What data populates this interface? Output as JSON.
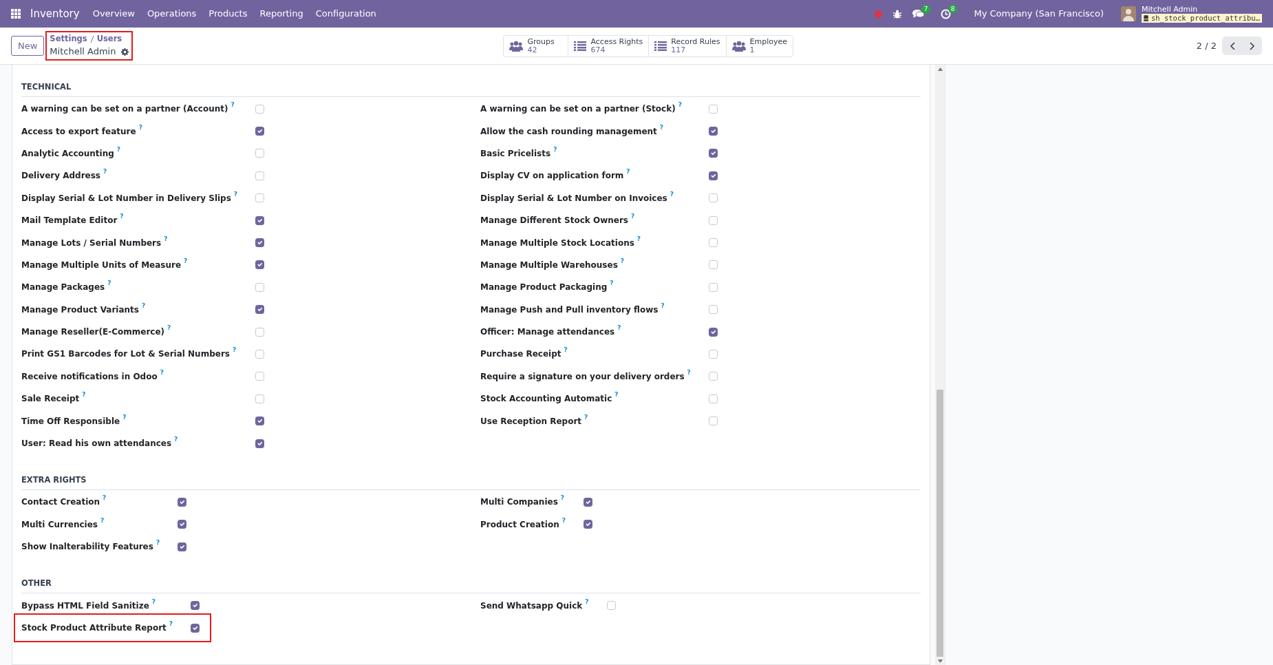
{
  "navbar": {
    "app_name": "Inventory",
    "menus": [
      "Overview",
      "Operations",
      "Products",
      "Reporting",
      "Configuration"
    ],
    "chat_count": "7",
    "activity_count": "8",
    "company": "My Company (San Francisco)",
    "user_name": "Mitchell Admin",
    "database": "sh_stock_product_attribu…"
  },
  "control_panel": {
    "new_button": "New",
    "breadcrumbs": [
      "Settings",
      "Users"
    ],
    "record_name": "Mitchell Admin",
    "highlighted": true,
    "smart_buttons": [
      {
        "kind": "group",
        "label": "Groups",
        "value": "42"
      },
      {
        "kind": "list",
        "label": "Access Rights",
        "value": "674"
      },
      {
        "kind": "list",
        "label": "Record Rules",
        "value": "117"
      },
      {
        "kind": "group",
        "label": "Employee",
        "value": "1"
      }
    ],
    "pager": "2 / 2"
  },
  "sections": [
    {
      "title": "TECHNICAL",
      "left": [
        {
          "label": "A warning can be set on a partner (Account)",
          "help": "?",
          "checked": false
        },
        {
          "label": "Access to export feature",
          "help": "?",
          "checked": true
        },
        {
          "label": "Analytic Accounting",
          "help": "?",
          "checked": false
        },
        {
          "label": "Delivery Address",
          "help": "?",
          "checked": false
        },
        {
          "label": "Display Serial & Lot Number in Delivery Slips",
          "help": "?",
          "checked": false
        },
        {
          "label": "Mail Template Editor",
          "help": "?",
          "checked": true
        },
        {
          "label": "Manage Lots / Serial Numbers",
          "help": "?",
          "checked": true
        },
        {
          "label": "Manage Multiple Units of Measure",
          "help": "?",
          "checked": true
        },
        {
          "label": "Manage Packages",
          "help": "?",
          "checked": false
        },
        {
          "label": "Manage Product Variants",
          "help": "?",
          "checked": true
        },
        {
          "label": "Manage Reseller(E-Commerce)",
          "help": "?",
          "checked": false
        },
        {
          "label": "Print GS1 Barcodes for Lot & Serial Numbers",
          "help": "?",
          "checked": false
        },
        {
          "label": "Receive notifications in Odoo",
          "help": "?",
          "checked": false
        },
        {
          "label": "Sale Receipt",
          "help": "?",
          "checked": false
        },
        {
          "label": "Time Off Responsible",
          "help": "?",
          "checked": true
        },
        {
          "label": "User: Read his own attendances",
          "help": "?",
          "checked": true
        }
      ],
      "right": [
        {
          "label": "A warning can be set on a partner (Stock)",
          "help": "?",
          "checked": false
        },
        {
          "label": "Allow the cash rounding management",
          "help": "?",
          "checked": true
        },
        {
          "label": "Basic Pricelists",
          "help": "?",
          "checked": true
        },
        {
          "label": "Display CV on application form",
          "help": "?",
          "checked": true
        },
        {
          "label": "Display Serial & Lot Number on Invoices",
          "help": "?",
          "checked": false
        },
        {
          "label": "Manage Different Stock Owners",
          "help": "?",
          "checked": false
        },
        {
          "label": "Manage Multiple Stock Locations",
          "help": "?",
          "checked": false
        },
        {
          "label": "Manage Multiple Warehouses",
          "help": "?",
          "checked": false
        },
        {
          "label": "Manage Product Packaging",
          "help": "?",
          "checked": false
        },
        {
          "label": "Manage Push and Pull inventory flows",
          "help": "?",
          "checked": false
        },
        {
          "label": "Officer: Manage attendances",
          "help": "?",
          "checked": true
        },
        {
          "label": "Purchase Receipt",
          "help": "?",
          "checked": false
        },
        {
          "label": "Require a signature on your delivery orders",
          "help": "?",
          "checked": false
        },
        {
          "label": "Stock Accounting Automatic",
          "help": "?",
          "checked": false
        },
        {
          "label": "Use Reception Report",
          "help": "?",
          "checked": false
        }
      ]
    },
    {
      "title": "EXTRA RIGHTS",
      "left": [
        {
          "label": "Contact Creation",
          "help": "?",
          "checked": true
        },
        {
          "label": "Multi Currencies",
          "help": "?",
          "checked": true
        },
        {
          "label": "Show Inalterability Features",
          "help": "?",
          "checked": true
        }
      ],
      "right": [
        {
          "label": "Multi Companies",
          "help": "?",
          "checked": true
        },
        {
          "label": "Product Creation",
          "help": "?",
          "checked": true
        }
      ]
    },
    {
      "title": "OTHER",
      "left": [
        {
          "label": "Bypass HTML Field Sanitize",
          "help": "?",
          "checked": true,
          "highlighted": false
        },
        {
          "label": "Stock Product Attribute Report",
          "help": "?",
          "checked": true,
          "highlighted": true
        }
      ],
      "right": [
        {
          "label": "Send Whatsapp Quick",
          "help": "?",
          "checked": false,
          "highlighted": false
        }
      ]
    }
  ]
}
